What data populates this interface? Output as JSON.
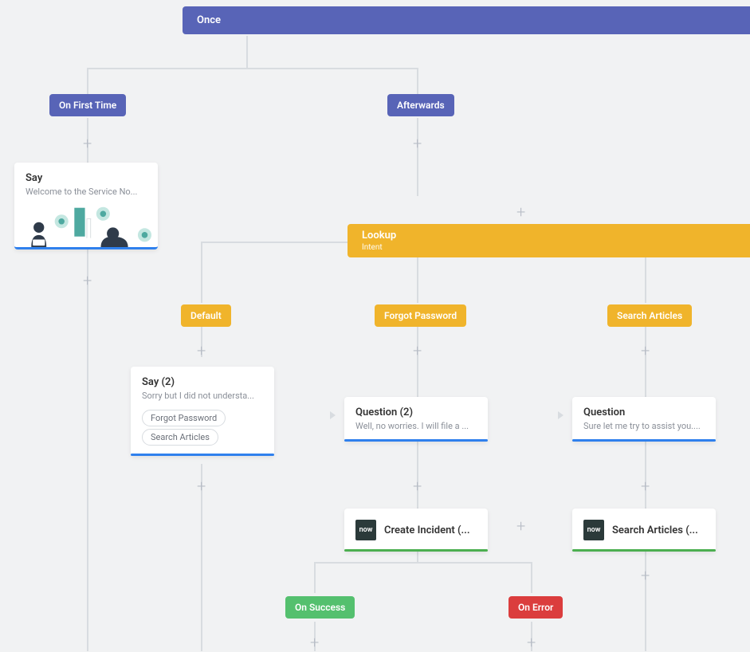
{
  "root": {
    "label": "Once"
  },
  "branches": {
    "first": "On First Time",
    "after": "Afterwards"
  },
  "say1": {
    "title": "Say",
    "desc": "Welcome to the Service No..."
  },
  "lookup": {
    "label": "Lookup",
    "sub": "Intent"
  },
  "options": {
    "default": "Default",
    "forgot": "Forgot Password",
    "search": "Search Articles"
  },
  "say2": {
    "title": "Say (2)",
    "desc": "Sorry but I did not understa...",
    "chips": [
      "Forgot Password",
      "Search Articles"
    ]
  },
  "q2": {
    "title": "Question (2)",
    "desc": "Well, no worries. I will file a ..."
  },
  "q1": {
    "title": "Question",
    "desc": "Sure let me try to assist you...."
  },
  "createIncident": {
    "logo": "now",
    "label": "Create Incident (..."
  },
  "searchArticles": {
    "logo": "now",
    "label": "Search Articles (..."
  },
  "outcome": {
    "success": "On Success",
    "error": "On Error"
  },
  "plus": "+"
}
